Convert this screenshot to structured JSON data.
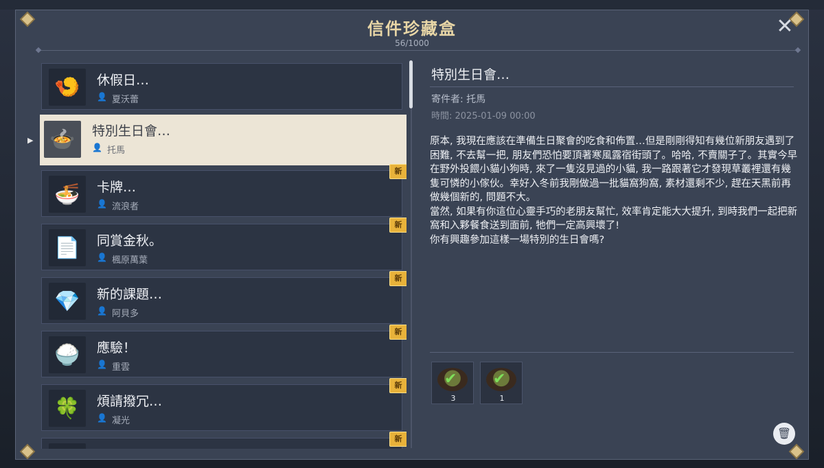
{
  "window": {
    "title": "信件珍藏盒",
    "count": "56/1000"
  },
  "colors": {
    "accent": "#e8d6a6",
    "new_badge": "#e8b23a",
    "selected_bg": "#ece5d6"
  },
  "letters": [
    {
      "subject": "休假日…",
      "sender": "夏沃蕾",
      "icon": "food-plate-icon",
      "is_new": false,
      "selected": false
    },
    {
      "subject": "特別生日會…",
      "sender": "托馬",
      "icon": "food-bowl-icon",
      "is_new": false,
      "selected": true
    },
    {
      "subject": "卡牌…",
      "sender": "流浪者",
      "icon": "noodle-bowl-icon",
      "is_new": true,
      "selected": false
    },
    {
      "subject": "同賞金秋。",
      "sender": "楓原萬葉",
      "icon": "folded-paper-icon",
      "is_new": true,
      "selected": false
    },
    {
      "subject": "新的課題…",
      "sender": "阿貝多",
      "icon": "crystal-flower-icon",
      "is_new": true,
      "selected": false
    },
    {
      "subject": "應驗！",
      "sender": "重雲",
      "icon": "rice-dish-icon",
      "is_new": true,
      "selected": false
    },
    {
      "subject": "煩請撥冗…",
      "sender": "凝光",
      "icon": "jade-crystal-icon",
      "is_new": true,
      "selected": false
    },
    {
      "subject": "",
      "sender": "",
      "icon": "",
      "is_new": true,
      "selected": false
    }
  ],
  "new_badge_label": "新",
  "detail": {
    "title": "特別生日會…",
    "sender_label": "寄件者: 托馬",
    "time_label": "時間: 2025-01-09 00:00",
    "body": [
      "原本, 我現在應該在準備生日聚會的吃食和佈置…但是剛剛得知有幾位新朋友遇到了困難, 不去幫一把, 朋友們恐怕要頂著寒風露宿街頭了。哈哈, 不賣關子了。其實今早在野外投餵小貓小狗時, 來了一隻沒見過的小貓, 我一路跟著它才發現草叢裡還有幾隻可憐的小傢伙。幸好入冬前我剛做過一批貓窩狗窩, 素材還剩不少, 趕在天黑前再做幾個新的, 問題不大。",
      "當然, 如果有你這位心靈手巧的老朋友幫忙, 效率肯定能大大提升, 到時我們一起把新窩和入夥餐食送到面前, 牠們一定高興壞了!",
      "你有興趣參加這樣一場特別的生日會嗎?"
    ],
    "attachments": [
      {
        "name": "food-dish-1",
        "quantity": "3",
        "icon": "stew-dish-icon",
        "claimed": true
      },
      {
        "name": "food-dish-2",
        "quantity": "1",
        "icon": "pot-dish-icon",
        "claimed": true
      }
    ]
  },
  "icons": {
    "close": "close-icon",
    "delete": "trash-icon",
    "sender": "person-icon"
  }
}
